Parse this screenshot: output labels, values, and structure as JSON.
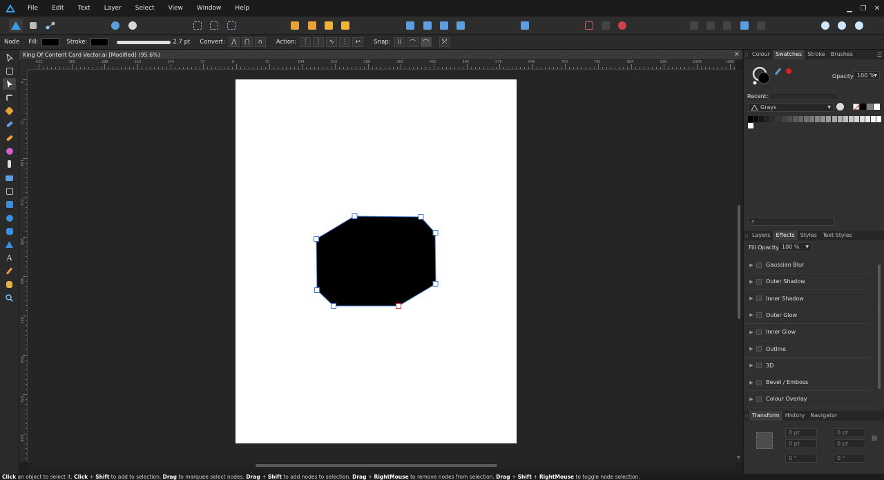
{
  "menubar": {
    "items": [
      "File",
      "Edit",
      "Text",
      "Layer",
      "Select",
      "View",
      "Window",
      "Help"
    ]
  },
  "context_toolbar": {
    "tool_name": "Node",
    "fill_label": "Fill:",
    "stroke_label": "Stroke:",
    "stroke_width": "2.7 pt",
    "convert_label": "Convert:",
    "action_label": "Action:",
    "snap_label": "Snap:",
    "fill_color": "#000000",
    "stroke_color": "#000000"
  },
  "document": {
    "tab_title": "King Of Content Card Vector.ai [Modified] (95.6%)",
    "close_glyph": "×"
  },
  "rulers": {
    "horizontal_labels": [
      "-432",
      "-360",
      "-288",
      "-216",
      "-144",
      "-72",
      "0",
      "72",
      "144",
      "216",
      "288",
      "360",
      "432",
      "504",
      "576",
      "648",
      "720",
      "792",
      "864",
      "936",
      "1008",
      "1080"
    ],
    "vertical_labels": [
      "0",
      "72",
      "144",
      "216",
      "288",
      "360",
      "432",
      "504",
      "576",
      "648"
    ]
  },
  "panels": {
    "top_tabs": [
      "Colour",
      "Swatches",
      "Stroke",
      "Brushes"
    ],
    "top_active": "Swatches",
    "opacity_label": "Opacity:",
    "opacity_value": "100 %",
    "recent_label": "Recent:",
    "palette_name": "Grays",
    "middle_tabs": [
      "Layers",
      "Effects",
      "Styles",
      "Text Styles"
    ],
    "middle_active": "Effects",
    "fill_opacity_label": "Fill Opacity:",
    "fill_opacity_value": "100 %",
    "effects": [
      "Gaussian Blur",
      "Outer Shadow",
      "Inner Shadow",
      "Outer Glow",
      "Inner Glow",
      "Outline",
      "3D",
      "Bevel / Emboss",
      "Colour Overlay"
    ],
    "bottom_tabs": [
      "Transform",
      "History",
      "Navigator"
    ],
    "bottom_active": "Transform",
    "transform_fields": [
      "0 pt",
      "0 pt",
      "0 pt",
      "0 pt",
      "0 °",
      "0 °"
    ]
  },
  "shape": {
    "fill": "#000000",
    "outline": "#4a7fd0",
    "selected_node_color": "#e03030"
  },
  "statusbar": {
    "parts": [
      {
        "b": "Click",
        "t": " an object to select it. "
      },
      {
        "b": "Click",
        "t": " + "
      },
      {
        "b": "Shift",
        "t": " to add to selection. "
      },
      {
        "b": "Drag",
        "t": " to marquee select nodes. "
      },
      {
        "b": "Drag",
        "t": " + "
      },
      {
        "b": "Shift",
        "t": " to add nodes to selection. "
      },
      {
        "b": "Drag",
        "t": " + "
      },
      {
        "b": "RightMouse",
        "t": " to remove nodes from selection. "
      },
      {
        "b": "Drag",
        "t": " + "
      },
      {
        "b": "Shift",
        "t": " + "
      },
      {
        "b": "RightMouse",
        "t": " to toggle node selection."
      }
    ]
  }
}
